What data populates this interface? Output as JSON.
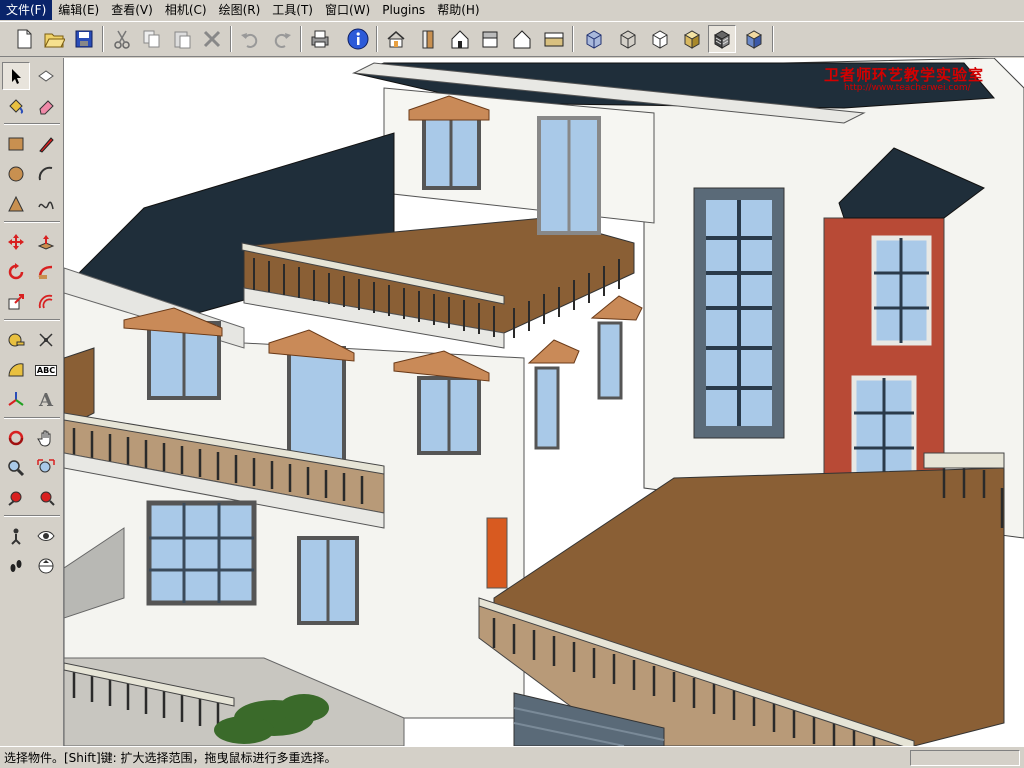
{
  "menu": {
    "items": [
      {
        "label": "文件(F)"
      },
      {
        "label": "编辑(E)"
      },
      {
        "label": "查看(V)"
      },
      {
        "label": "相机(C)"
      },
      {
        "label": "绘图(R)"
      },
      {
        "label": "工具(T)"
      },
      {
        "label": "窗口(W)"
      },
      {
        "label": "Plugins"
      },
      {
        "label": "帮助(H)"
      }
    ]
  },
  "tools": {
    "abc_label": "ABC",
    "dimension_label": "A"
  },
  "watermark": {
    "title": "卫者师环艺教学实验室",
    "url": "http://www.teacherwei.com/"
  },
  "status": {
    "text": "选择物件。[Shift]键: 扩大选择范围，拖曳鼠标进行多重选择。"
  },
  "colors": {
    "wall": "#f4f4f0",
    "roof": "#1f2e3a",
    "deck": "#8a5f35",
    "trim": "#c98a58",
    "accent_wall": "#b84a36",
    "glass": "#a9c9e8"
  }
}
